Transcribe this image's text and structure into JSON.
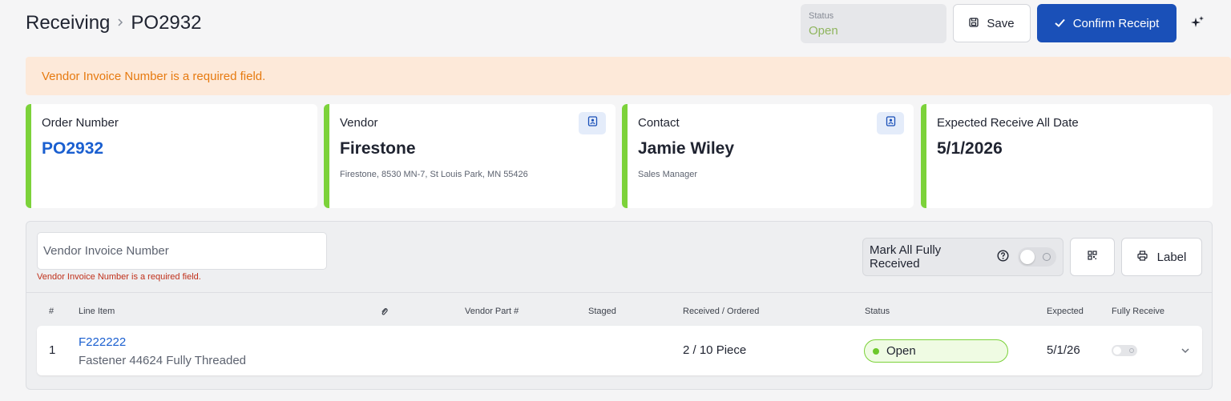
{
  "header": {
    "breadcrumb_root": "Receiving",
    "breadcrumb_current": "PO2932",
    "status_label": "Status",
    "status_value": "Open",
    "save_label": "Save",
    "confirm_label": "Confirm Receipt"
  },
  "alert": {
    "message": "Vendor Invoice Number is a required field."
  },
  "cards": [
    {
      "title": "Order Number",
      "value": "PO2932",
      "sub": ""
    },
    {
      "title": "Vendor",
      "value": "Firestone",
      "sub": "Firestone, 8530 MN-7, St Louis Park, MN 55426"
    },
    {
      "title": "Contact",
      "value": "Jamie Wiley",
      "sub": "Sales Manager"
    },
    {
      "title": "Expected Receive All Date",
      "value": "5/1/2026",
      "sub": ""
    }
  ],
  "form": {
    "invoice_placeholder": "Vendor Invoice Number",
    "invoice_value": "",
    "invoice_error": "Vendor Invoice Number is a required field.",
    "mark_all_label": "Mark All Fully Received",
    "mark_all_on": false,
    "label_button": "Label"
  },
  "table": {
    "columns": [
      "#",
      "Line Item",
      "Vendor Part #",
      "Staged",
      "Received / Ordered",
      "Status",
      "Expected",
      "Fully Receive"
    ],
    "rows": [
      {
        "index": "1",
        "item_code": "F222222",
        "item_desc": "Fastener 44624 Fully Threaded",
        "vendor_part": "",
        "staged": "",
        "received_ordered": "2 / 10 Piece",
        "status": "Open",
        "expected": "5/1/26",
        "fully_receive": false
      }
    ]
  },
  "colors": {
    "primary": "#1a50b8",
    "accent_green": "#7cd23a",
    "alert_bg": "#fde9d9",
    "alert_text": "#e67a10",
    "error_text": "#c0301a",
    "link": "#1a5fd0"
  },
  "icons": [
    "chevron-right-icon",
    "save-icon",
    "check-icon",
    "sparkle-icon",
    "contact-card-icon",
    "help-icon",
    "qr-code-icon",
    "printer-icon",
    "paperclip-icon",
    "chevron-down-icon"
  ]
}
